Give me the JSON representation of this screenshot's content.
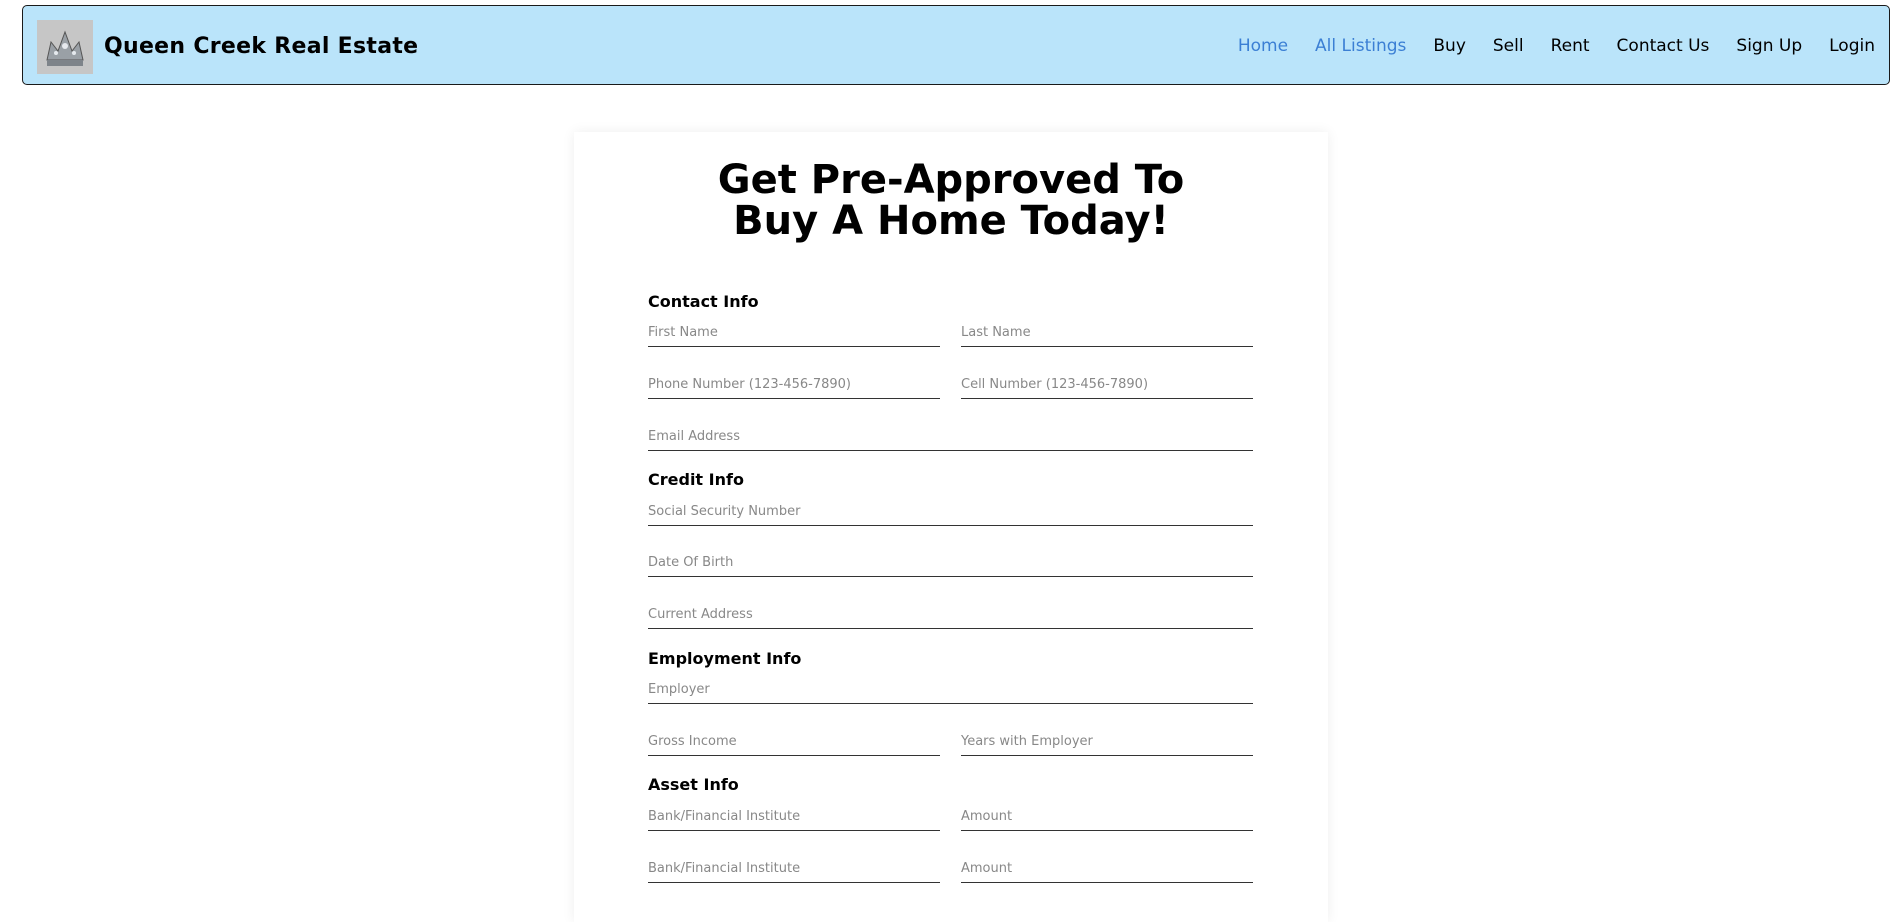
{
  "brand": {
    "name": "Queen Creek Real Estate"
  },
  "nav": [
    {
      "label": "Home",
      "active": true
    },
    {
      "label": "All Listings",
      "active": true
    },
    {
      "label": "Buy",
      "active": false
    },
    {
      "label": "Sell",
      "active": false
    },
    {
      "label": "Rent",
      "active": false
    },
    {
      "label": "Contact Us",
      "active": false
    },
    {
      "label": "Sign Up",
      "active": false
    },
    {
      "label": "Login",
      "active": false
    }
  ],
  "colors": {
    "navbar_bg": "#bae4fa",
    "active_link": "#3b7fd4"
  },
  "form": {
    "title": "Get Pre-Approved To Buy A Home Today!",
    "sections": {
      "contact": "Contact Info",
      "credit": "Credit Info",
      "employment": "Employment Info",
      "asset": "Asset Info"
    },
    "placeholders": {
      "first_name": "First Name",
      "last_name": "Last Name",
      "phone": "Phone Number (123-456-7890)",
      "cell": "Cell Number (123-456-7890)",
      "email": "Email Address",
      "ssn": "Social Security Number",
      "dob": "Date Of Birth",
      "address": "Current Address",
      "employer": "Employer",
      "gross_income": "Gross Income",
      "years_employer": "Years with Employer",
      "bank_1": "Bank/Financial Institute",
      "amount_1": "Amount",
      "bank_2": "Bank/Financial Institute",
      "amount_2": "Amount"
    }
  }
}
